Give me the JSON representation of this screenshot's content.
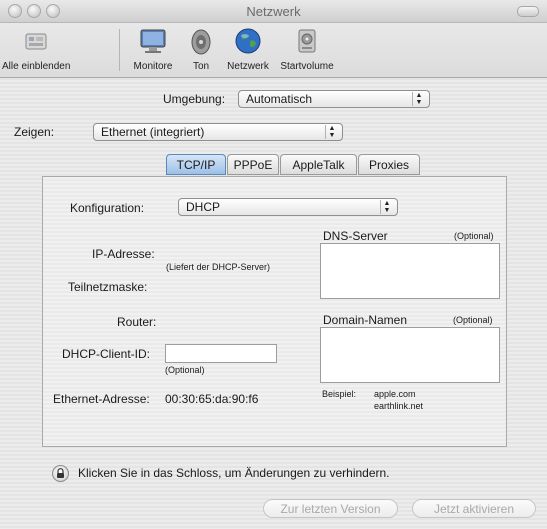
{
  "window": {
    "title": "Netzwerk"
  },
  "toolbar": {
    "items": [
      {
        "label": "Alle einblenden",
        "icon": "show-all-icon"
      },
      {
        "label": "Monitore",
        "icon": "monitor-icon"
      },
      {
        "label": "Ton",
        "icon": "speaker-icon"
      },
      {
        "label": "Netzwerk",
        "icon": "globe-icon"
      },
      {
        "label": "Startvolume",
        "icon": "disk-icon"
      }
    ]
  },
  "location": {
    "label": "Umgebung:",
    "value": "Automatisch"
  },
  "show": {
    "label": "Zeigen:",
    "value": "Ethernet (integriert)"
  },
  "tabs": [
    {
      "label": "TCP/IP",
      "active": true
    },
    {
      "label": "PPPoE",
      "active": false
    },
    {
      "label": "AppleTalk",
      "active": false
    },
    {
      "label": "Proxies",
      "active": false
    }
  ],
  "config": {
    "label": "Konfiguration:",
    "value": "DHCP"
  },
  "fields": {
    "ip_label": "IP-Adresse:",
    "ip_hint": "(Liefert der DHCP-Server)",
    "subnet_label": "Teilnetzmaske:",
    "router_label": "Router:",
    "dhcp_client_label": "DHCP-Client-ID:",
    "dhcp_client_value": "",
    "dhcp_client_hint": "(Optional)",
    "ethernet_label": "Ethernet-Adresse:",
    "ethernet_value": "00:30:65:da:90:f6"
  },
  "dns": {
    "label": "DNS-Server",
    "optional": "(Optional)",
    "value": ""
  },
  "domain": {
    "label": "Domain-Namen",
    "optional": "(Optional)",
    "value": "",
    "example_label": "Beispiel:",
    "example_1": "apple.com",
    "example_2": "earthlink.net"
  },
  "lock_text": "Klicken Sie in das Schloss, um Änderungen zu verhindern.",
  "buttons": {
    "revert": "Zur letzten Version",
    "apply": "Jetzt aktivieren"
  },
  "colors": {
    "active_tab": "#9cc0e8",
    "panel_border": "#a9a9a9"
  }
}
